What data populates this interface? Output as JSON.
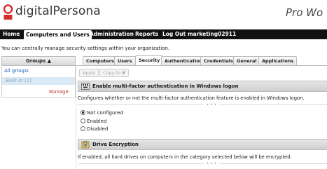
{
  "brand": {
    "name": "digitalPersona",
    "product": "Pro Wo"
  },
  "nav": {
    "items": [
      {
        "label": "Home"
      },
      {
        "label": "Computers and Users"
      },
      {
        "label": "Administration"
      },
      {
        "label": "Reports"
      },
      {
        "label": "Log Out marketing02911"
      }
    ]
  },
  "intro": "You can centrally manage security settings within your organization.",
  "groups": {
    "header": "Groups",
    "sort_glyph": "▲",
    "items": [
      {
        "label": "All groups"
      },
      {
        "label": "Built-in (1)"
      }
    ],
    "manage": "Manage"
  },
  "tabs": [
    {
      "label": "Computers"
    },
    {
      "label": "Users"
    },
    {
      "label": "Security"
    },
    {
      "label": "Authentication"
    },
    {
      "label": "Credentials"
    },
    {
      "label": "General"
    },
    {
      "label": "Applications"
    }
  ],
  "toolbar": {
    "apply": "Apply",
    "copy_to": "Copy to ▼"
  },
  "sections": [
    {
      "title": "Enable multi-factor authentication in Windows logon",
      "description": "Configures whether or not the multi-factor authentication feature is enabled in Windows logon.",
      "options": [
        {
          "label": "Not configured",
          "selected": true
        },
        {
          "label": "Enabled",
          "selected": false
        },
        {
          "label": "Disabled",
          "selected": false
        }
      ]
    },
    {
      "title": "Drive Encryption",
      "description": "If enabled, all hard drives on computers in the category selected below will be encrypted."
    }
  ],
  "colors": {
    "nav_bg": "#111111",
    "link": "#1a5ec2",
    "manage": "#c0392b",
    "selected_group_bg": "#dbe8f6"
  }
}
